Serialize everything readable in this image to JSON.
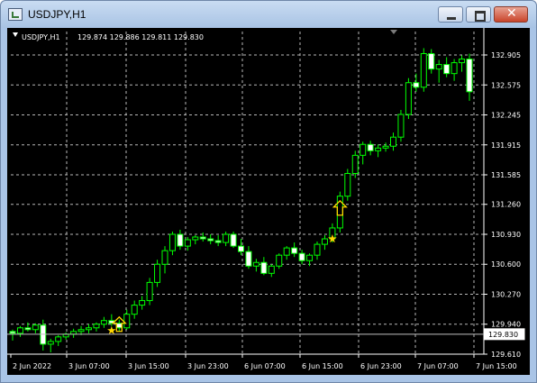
{
  "window": {
    "title": "USDJPY,H1"
  },
  "chart_info": {
    "symbol": "USDJPY,H1",
    "ohlc": "129.874 129.886 129.811 129.830"
  },
  "chart_data": {
    "type": "candlestick",
    "symbol": "USDJPY,H1",
    "price_labels": [
      "132.905",
      "132.575",
      "132.245",
      "131.915",
      "131.585",
      "131.260",
      "130.930",
      "130.600",
      "130.270",
      "129.940",
      "129.610"
    ],
    "current_price": "129.830",
    "time_labels": [
      "2 Jun 2022",
      "3 Jun 07:00",
      "3 Jun 15:00",
      "3 Jun 23:00",
      "6 Jun 07:00",
      "6 Jun 15:00",
      "6 Jun 23:00",
      "7 Jun 07:00",
      "7 Jun 15:00"
    ],
    "ylim": [
      129.61,
      132.905
    ],
    "grid": true,
    "up_color": "#00ff00",
    "down_color": "#ffffff",
    "marker_color": "#ffd700",
    "candles": [
      [
        129.86,
        129.88,
        129.76,
        129.84
      ],
      [
        129.84,
        129.92,
        129.8,
        129.9
      ],
      [
        129.9,
        129.96,
        129.86,
        129.88
      ],
      [
        129.88,
        129.95,
        129.84,
        129.93
      ],
      [
        129.93,
        129.99,
        129.65,
        129.72
      ],
      [
        129.72,
        129.78,
        129.63,
        129.75
      ],
      [
        129.75,
        129.82,
        129.7,
        129.8
      ],
      [
        129.8,
        129.85,
        129.77,
        129.83
      ],
      [
        129.83,
        129.89,
        129.79,
        129.86
      ],
      [
        129.86,
        129.92,
        129.82,
        129.88
      ],
      [
        129.88,
        129.94,
        129.84,
        129.9
      ],
      [
        129.9,
        129.96,
        129.86,
        129.94
      ],
      [
        129.94,
        130.02,
        129.9,
        129.98
      ],
      [
        129.98,
        130.05,
        129.92,
        129.95
      ],
      [
        129.95,
        129.99,
        129.86,
        129.9
      ],
      [
        129.9,
        130.1,
        129.88,
        130.05
      ],
      [
        130.05,
        130.2,
        130.0,
        130.15
      ],
      [
        130.15,
        130.25,
        130.1,
        130.2
      ],
      [
        130.2,
        130.45,
        130.15,
        130.4
      ],
      [
        130.4,
        130.65,
        130.35,
        130.6
      ],
      [
        130.6,
        130.8,
        130.5,
        130.75
      ],
      [
        130.75,
        130.96,
        130.7,
        130.93
      ],
      [
        130.93,
        130.98,
        130.76,
        130.8
      ],
      [
        130.8,
        130.9,
        130.75,
        130.87
      ],
      [
        130.87,
        130.92,
        130.82,
        130.9
      ],
      [
        130.9,
        130.95,
        130.85,
        130.88
      ],
      [
        130.88,
        130.93,
        130.82,
        130.86
      ],
      [
        130.86,
        130.92,
        130.8,
        130.84
      ],
      [
        130.84,
        130.96,
        130.8,
        130.93
      ],
      [
        130.93,
        130.96,
        130.78,
        130.8
      ],
      [
        130.8,
        130.88,
        130.7,
        130.74
      ],
      [
        130.74,
        130.8,
        130.55,
        130.58
      ],
      [
        130.58,
        130.66,
        130.52,
        130.62
      ],
      [
        130.62,
        130.68,
        130.48,
        130.5
      ],
      [
        130.5,
        130.6,
        130.46,
        130.58
      ],
      [
        130.58,
        130.72,
        130.55,
        130.7
      ],
      [
        130.7,
        130.8,
        130.65,
        130.78
      ],
      [
        130.78,
        130.84,
        130.68,
        130.72
      ],
      [
        130.72,
        130.76,
        130.6,
        130.64
      ],
      [
        130.64,
        130.72,
        130.58,
        130.7
      ],
      [
        130.7,
        130.85,
        130.65,
        130.82
      ],
      [
        130.82,
        130.92,
        130.76,
        130.88
      ],
      [
        130.88,
        131.05,
        130.84,
        131.0
      ],
      [
        131.0,
        131.4,
        130.95,
        131.35
      ],
      [
        131.35,
        131.65,
        131.3,
        131.6
      ],
      [
        131.6,
        131.85,
        131.55,
        131.8
      ],
      [
        131.8,
        131.95,
        131.7,
        131.92
      ],
      [
        131.92,
        131.96,
        131.8,
        131.85
      ],
      [
        131.85,
        131.92,
        131.78,
        131.88
      ],
      [
        131.88,
        131.94,
        131.84,
        131.9
      ],
      [
        131.9,
        132.05,
        131.85,
        132.0
      ],
      [
        132.0,
        132.3,
        131.95,
        132.25
      ],
      [
        132.25,
        132.65,
        132.2,
        132.6
      ],
      [
        132.6,
        132.7,
        132.5,
        132.55
      ],
      [
        132.55,
        132.98,
        132.5,
        132.92
      ],
      [
        132.92,
        132.97,
        132.7,
        132.75
      ],
      [
        132.75,
        132.85,
        132.6,
        132.8
      ],
      [
        132.8,
        132.88,
        132.66,
        132.7
      ],
      [
        132.7,
        132.86,
        132.62,
        132.82
      ],
      [
        132.82,
        132.9,
        132.72,
        132.86
      ],
      [
        132.86,
        132.92,
        132.4,
        132.5
      ]
    ],
    "markers": [
      {
        "type": "up-arrow",
        "index": 14,
        "price": 129.94
      },
      {
        "type": "star",
        "index": 13,
        "price": 129.87
      },
      {
        "type": "up-arrow",
        "index": 43,
        "price": 131.22
      },
      {
        "type": "star",
        "index": 42,
        "price": 130.88
      }
    ]
  }
}
